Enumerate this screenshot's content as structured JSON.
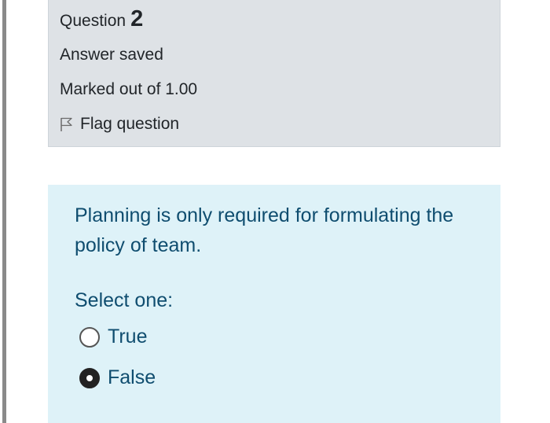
{
  "question_info": {
    "label": "Question",
    "number": "2",
    "state": "Answer saved",
    "grade": "Marked out of 1.00",
    "flag_label": "Flag question",
    "flag_icon": "flag-icon"
  },
  "question": {
    "text": "Planning is only required for formulating the policy of team.",
    "prompt": "Select one:",
    "options": [
      {
        "label": "True",
        "selected": false
      },
      {
        "label": "False",
        "selected": true
      }
    ]
  },
  "colors": {
    "info_background": "#dee2e6",
    "content_background": "#def2f8",
    "question_text": "#0f4d6f"
  }
}
